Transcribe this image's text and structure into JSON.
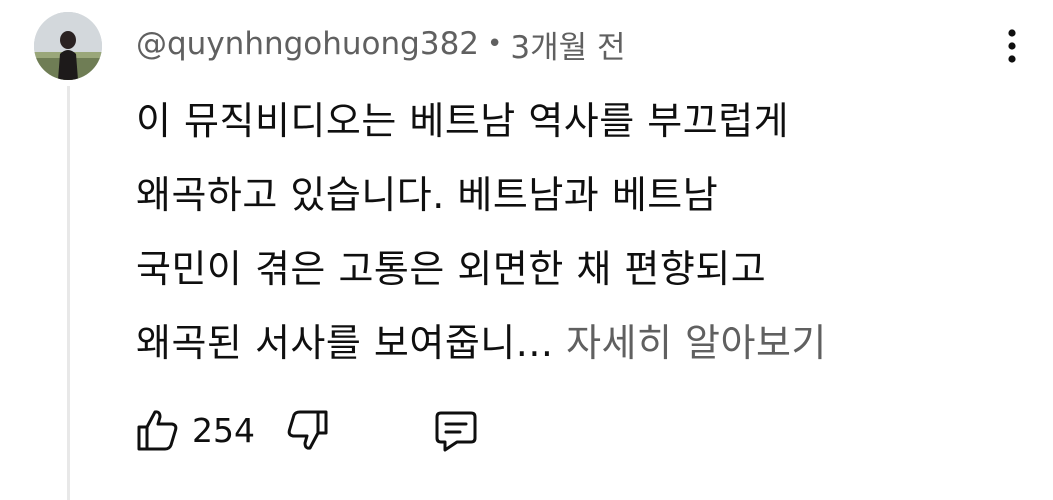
{
  "comment": {
    "author": "@quynhngohuong382",
    "separator": "•",
    "time": "3개월 전",
    "text_lines": [
      "이 뮤직비디오는 베트남 역사를 부끄럽게",
      "왜곡하고 있습니다. 베트남과 베트남",
      "국민이 겪은 고통은 외면한 채 편향되고",
      "왜곡된 서사를 보여줍니..."
    ],
    "read_more": "자세히 알아보기",
    "like_count": "254"
  },
  "icons": {
    "avatar": "user-avatar",
    "more": "more-vertical-icon",
    "like": "thumb-up-icon",
    "dislike": "thumb-down-icon",
    "reply": "comment-reply-icon"
  },
  "colors": {
    "text_primary": "#0f0f0f",
    "text_secondary": "#606060",
    "thread_line": "#e8e8e8"
  }
}
